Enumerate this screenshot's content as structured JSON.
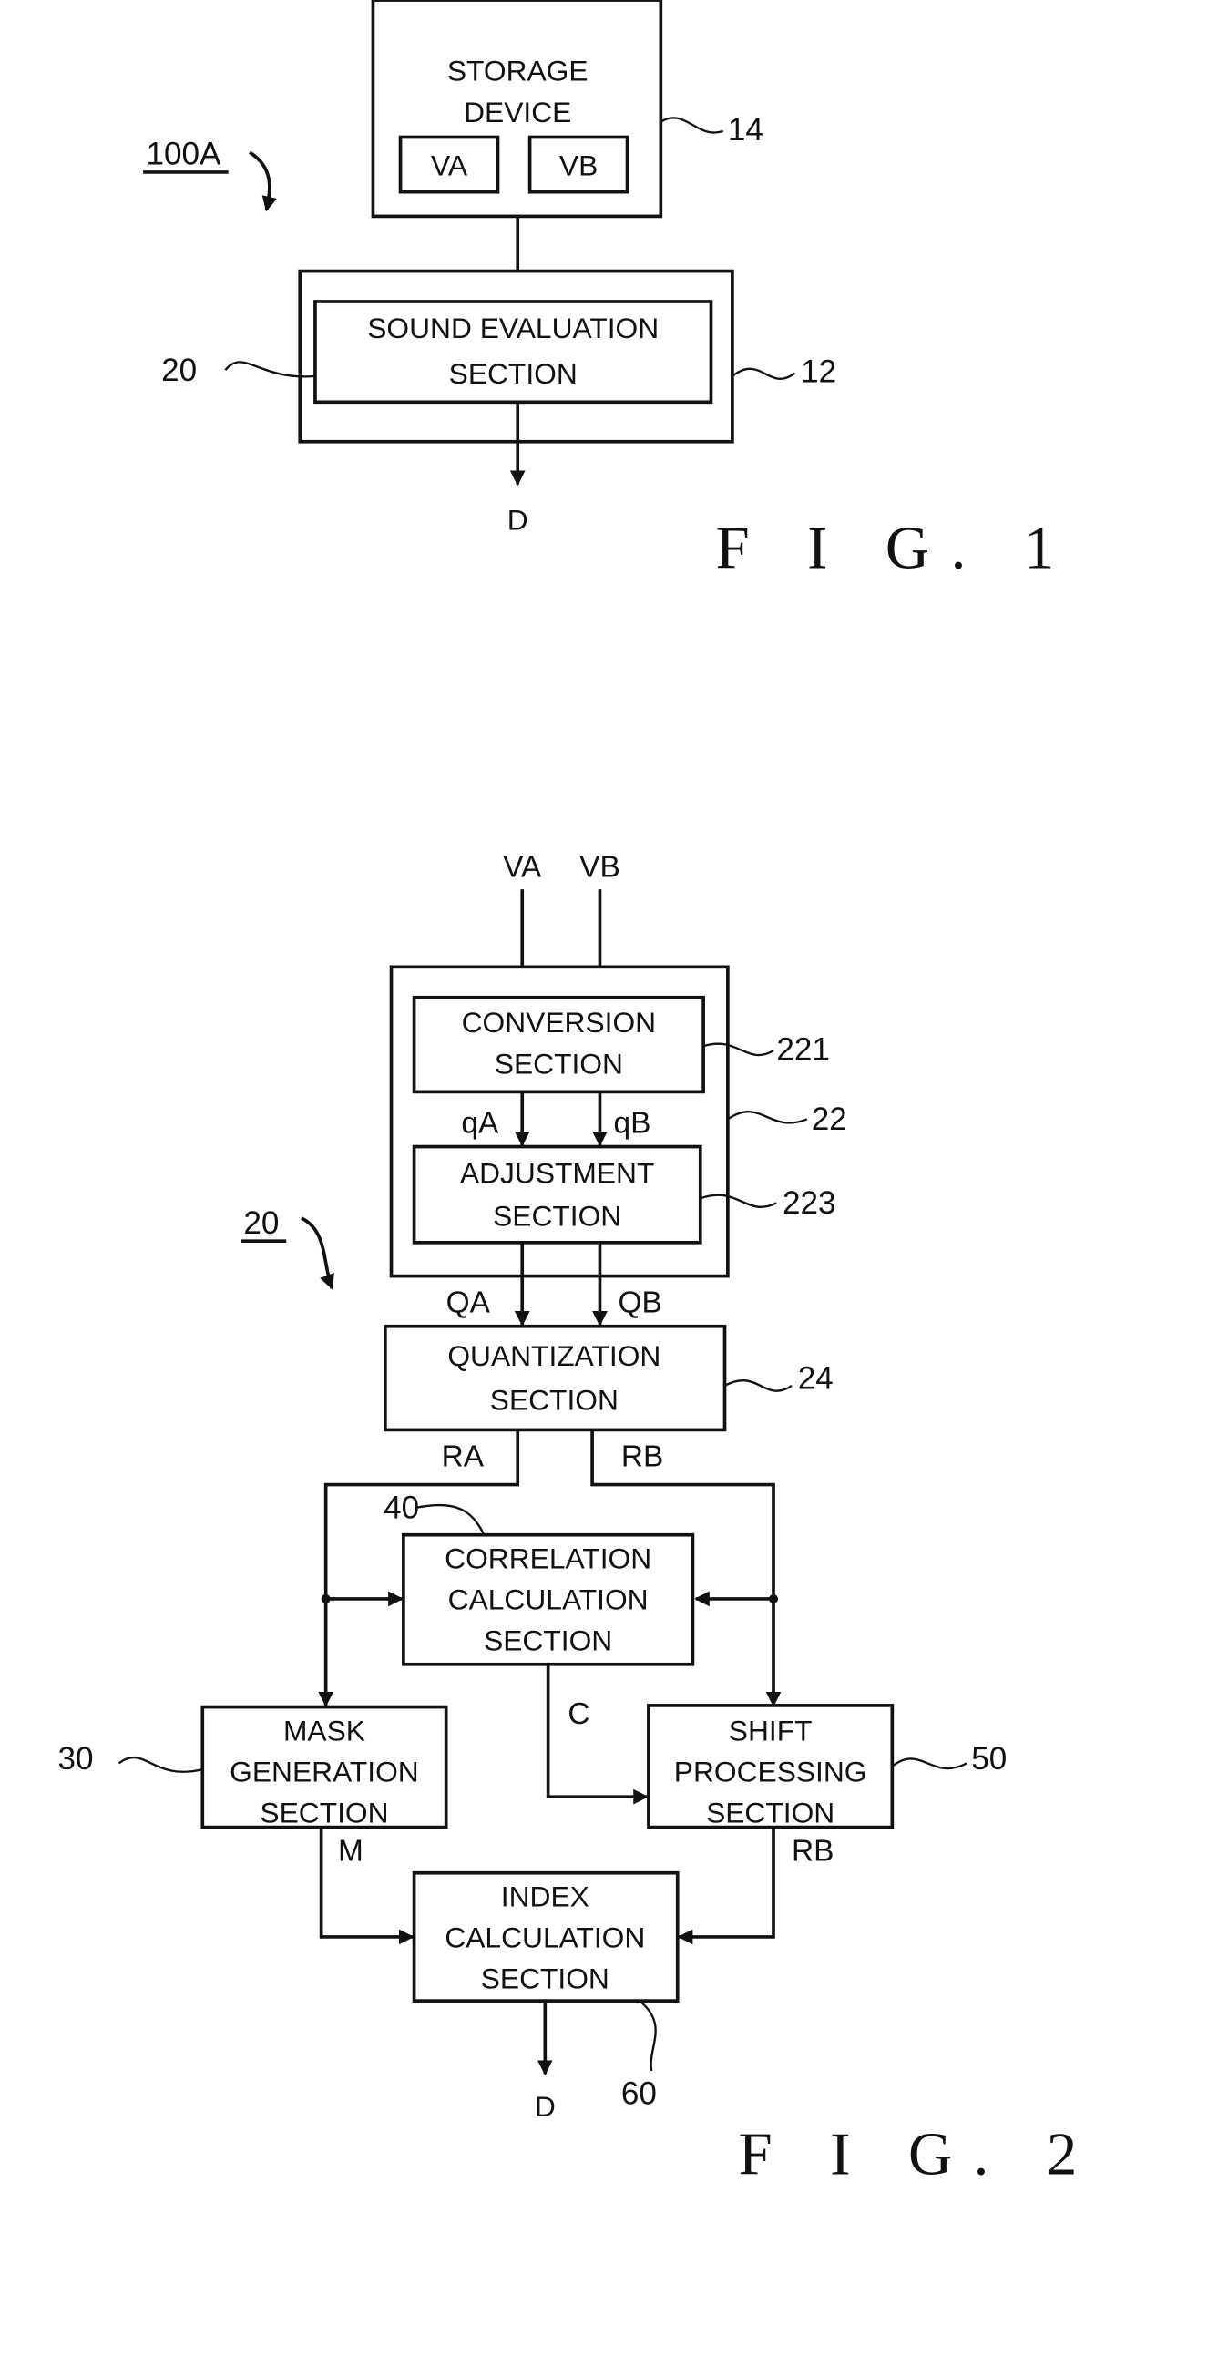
{
  "fig1": {
    "caption": "F I G. 1",
    "system_ref": "100A",
    "storage": {
      "line1": "STORAGE",
      "line2": "DEVICE",
      "ref": "14",
      "items": [
        "VA",
        "VB"
      ]
    },
    "outer_ref": "12",
    "sound_eval": {
      "line1": "SOUND EVALUATION",
      "line2": "SECTION",
      "ref": "20"
    },
    "output": "D"
  },
  "fig2": {
    "caption": "F I G. 2",
    "system_ref": "20",
    "inputs": [
      "VA",
      "VB"
    ],
    "group_ref": "22",
    "conversion": {
      "line1": "CONVERSION",
      "line2": "SECTION",
      "ref": "221"
    },
    "adjustment": {
      "line1": "ADJUSTMENT",
      "line2": "SECTION",
      "ref": "223"
    },
    "mid_signals": [
      "qA",
      "qB"
    ],
    "group_out_signals": [
      "QA",
      "QB"
    ],
    "quantization": {
      "line1": "QUANTIZATION",
      "line2": "SECTION",
      "ref": "24"
    },
    "quant_out_signals": [
      "RA",
      "RB"
    ],
    "correlation": {
      "line1": "CORRELATION",
      "line2": "CALCULATION",
      "line3": "SECTION",
      "ref": "40"
    },
    "mask": {
      "line1": "MASK",
      "line2": "GENERATION",
      "line3": "SECTION",
      "ref": "30"
    },
    "shift": {
      "line1": "SHIFT",
      "line2": "PROCESSING",
      "line3": "SECTION",
      "ref": "50"
    },
    "index": {
      "line1": "INDEX",
      "line2": "CALCULATION",
      "line3": "SECTION",
      "ref": "60"
    },
    "signal_c": "C",
    "signal_m": "M",
    "signal_rb": "RB",
    "output": "D"
  }
}
